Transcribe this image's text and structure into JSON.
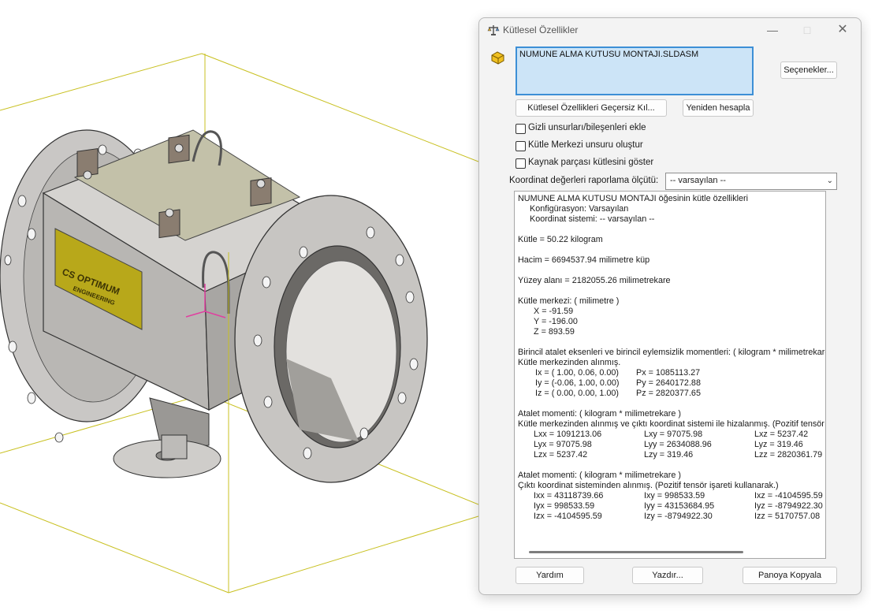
{
  "dialog": {
    "title": "Kütlesel Özellikler",
    "filename": "NUMUNE ALMA KUTUSU MONTAJI.SLDASM",
    "options_button": "Seçenekler...",
    "override_button": "Kütlesel Özellikleri Geçersiz Kıl...",
    "recalc_button": "Yeniden hesapla",
    "checkboxes": [
      {
        "label": "Gizli unsurları/bileşenleri ekle",
        "checked": false
      },
      {
        "label": "Kütle Merkezi unsuru oluştur",
        "checked": false
      },
      {
        "label": "Kaynak parçası kütlesini göster",
        "checked": false
      }
    ],
    "coord_label": "Koordinat değerleri raporlama ölçütü:",
    "coord_value": "-- varsayılan --",
    "help_button": "Yardım",
    "print_button": "Yazdır...",
    "copy_button": "Panoya Kopyala"
  },
  "report": {
    "header": "NUMUNE ALMA KUTUSU MONTAJI öğesinin kütle özellikleri",
    "config": "Konfigürasyon: Varsayılan",
    "coord_sys": "Koordinat sistemi: -- varsayılan --",
    "mass": "Kütle = 50.22 kilogram",
    "volume": "Hacim = 6694537.94 milimetre küp",
    "area": "Yüzey alanı = 2182055.26  milimetrekare",
    "com_title": "Kütle merkezi: ( milimetre )",
    "com_x": "X = -91.59",
    "com_y": "Y = -196.00",
    "com_z": "Z = 893.59",
    "principal_title": "Birincil atalet eksenleri ve birincil eylemsizlik momentleri: ( kilogram *  milimetrekare )",
    "principal_sub": "Kütle merkezinden alınmış.",
    "principal_rows": [
      [
        "Ix = ( 1.00,  0.06,  0.00)",
        "Px = 1085113.27"
      ],
      [
        "Iy = (-0.06,  1.00,  0.00)",
        "Py = 2640172.88"
      ],
      [
        "Iz = ( 0.00,  0.00,  1.00)",
        "Pz = 2820377.65"
      ]
    ],
    "moment1_title": "Atalet momenti: ( kilogram *  milimetrekare )",
    "moment1_sub": "Kütle merkezinden alınmış ve çıktı koordinat sistemi ile hizalanmış. (Pozitif tensör işareti kullanarak.)",
    "moment1_rows": [
      [
        "Lxx = 1091213.06",
        "Lxy = 97075.98",
        "Lxz = 5237.42"
      ],
      [
        "Lyx = 97075.98",
        "Lyy = 2634088.96",
        "Lyz = 319.46"
      ],
      [
        "Lzx = 5237.42",
        "Lzy = 319.46",
        "Lzz = 2820361.79"
      ]
    ],
    "moment2_title": "Atalet momenti: ( kilogram *  milimetrekare )",
    "moment2_sub": "Çıktı koordinat sisteminden alınmış. (Pozitif tensör işareti kullanarak.)",
    "moment2_rows": [
      [
        "Ixx = 43118739.66",
        "Ixy = 998533.59",
        "Ixz = -4104595.59"
      ],
      [
        "Iyx = 998533.59",
        "Iyy = 43153684.95",
        "Iyz = -8794922.30"
      ],
      [
        "Izx = -4104595.59",
        "Izy = -8794922.30",
        "Izz = 5170757.08"
      ]
    ]
  },
  "colors": {
    "accent": "#3c8fd6",
    "selection": "#cce4f7",
    "bbox": "#c8c020",
    "nameplate": "#b8a81a"
  }
}
